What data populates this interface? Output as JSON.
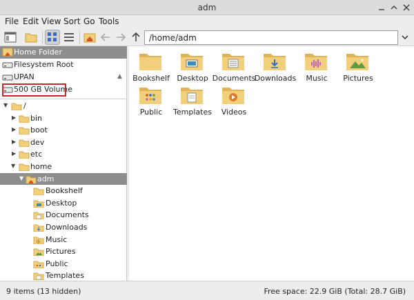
{
  "window": {
    "title": "adm"
  },
  "menu": [
    "File",
    "Edit",
    "View",
    "Sort",
    "Go",
    "Tools"
  ],
  "toolbar": {
    "path": "/home/adm"
  },
  "places": [
    {
      "label": "Home Folder",
      "icon": "home-icon",
      "selected": true
    },
    {
      "label": "Filesystem Root",
      "icon": "drive-icon"
    },
    {
      "label": "UPAN",
      "icon": "drive-icon",
      "eject": true
    },
    {
      "label": "500 GB Volume",
      "icon": "drive-icon",
      "highlighted": true
    }
  ],
  "tree": [
    {
      "label": "/",
      "expanded": true
    },
    {
      "label": "bin"
    },
    {
      "label": "boot"
    },
    {
      "label": "dev"
    },
    {
      "label": "etc"
    },
    {
      "label": "home",
      "expanded": true
    },
    {
      "label": "adm",
      "expanded": true,
      "selected": true
    },
    {
      "label": "Bookshelf"
    },
    {
      "label": "Desktop"
    },
    {
      "label": "Documents"
    },
    {
      "label": "Downloads"
    },
    {
      "label": "Music"
    },
    {
      "label": "Pictures"
    },
    {
      "label": "Public"
    },
    {
      "label": "Templates"
    }
  ],
  "items": [
    {
      "label": "Bookshelf",
      "icon": "folder-icon"
    },
    {
      "label": "Desktop",
      "icon": "desktop-folder-icon"
    },
    {
      "label": "Documents",
      "icon": "documents-folder-icon"
    },
    {
      "label": "Downloads",
      "icon": "downloads-folder-icon"
    },
    {
      "label": "Music",
      "icon": "music-folder-icon"
    },
    {
      "label": "Pictures",
      "icon": "pictures-folder-icon"
    },
    {
      "label": "Public",
      "icon": "public-folder-icon"
    },
    {
      "label": "Templates",
      "icon": "templates-folder-icon"
    },
    {
      "label": "Videos",
      "icon": "videos-folder-icon"
    }
  ],
  "status": {
    "left": "9 items (13 hidden)",
    "right": "Free space: 22.9 GiB (Total: 28.7 GiB)"
  },
  "colors": {
    "folder": "#f2cf7a",
    "folder_dark": "#e0b35b",
    "selection": "#8d8d8d",
    "highlight_box": "#c9262c"
  }
}
